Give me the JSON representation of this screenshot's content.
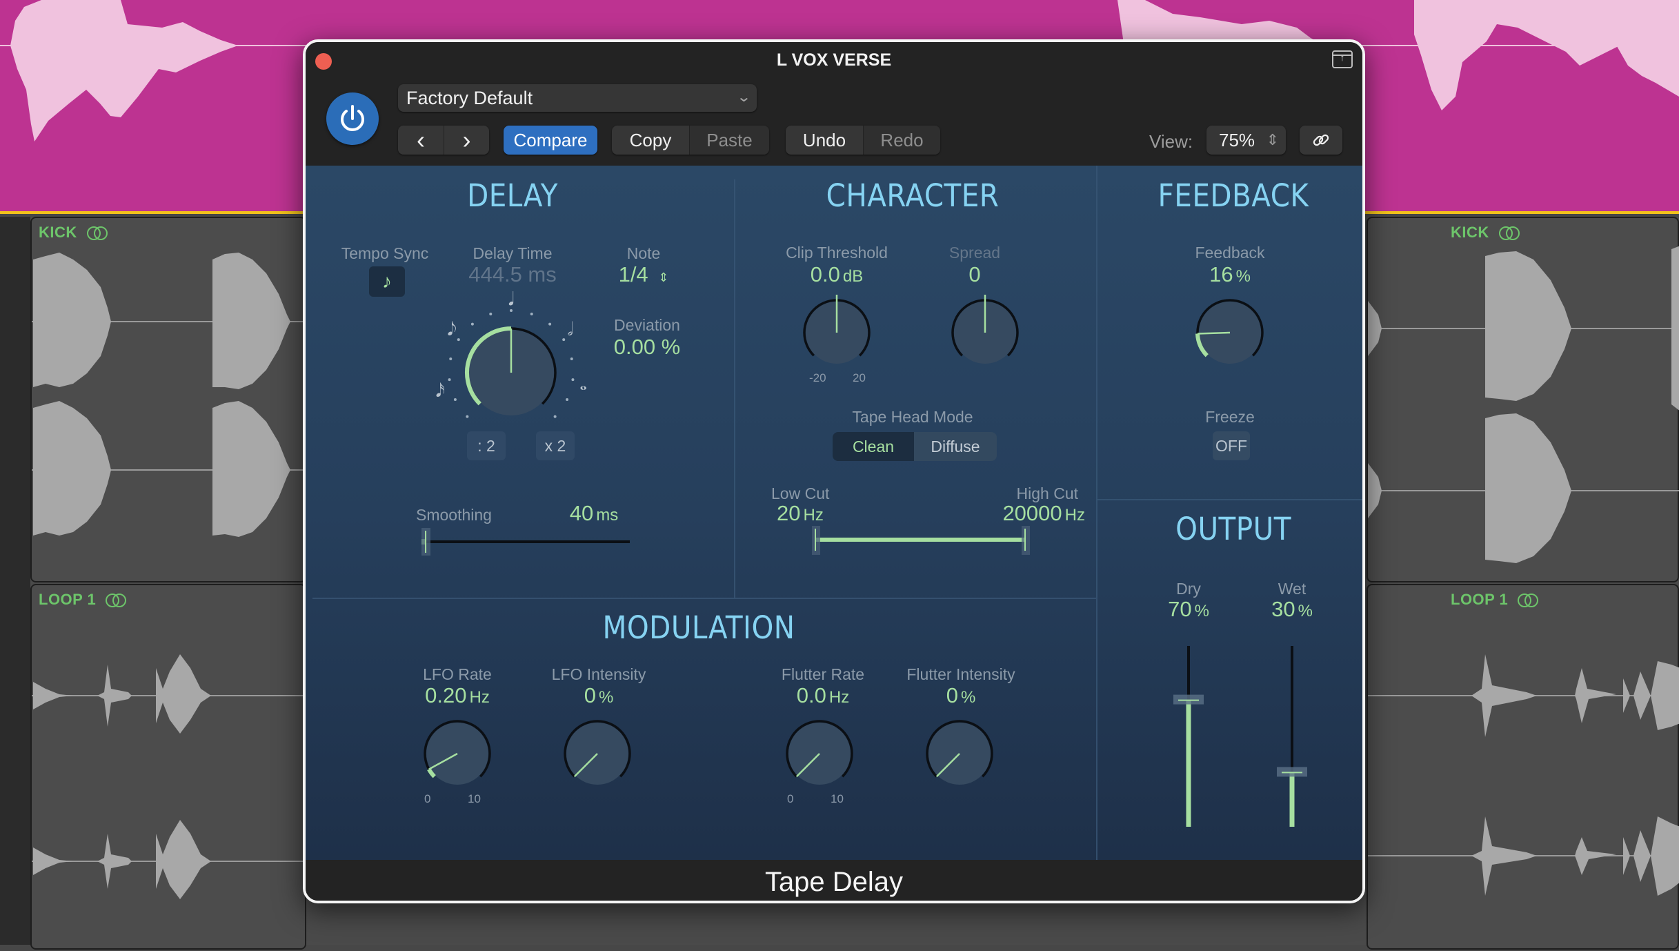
{
  "background": {
    "vox_region_color": "#bd3391",
    "tracks": [
      {
        "name": "KICK",
        "icon": "loop-icon"
      },
      {
        "name": "LOOP 1",
        "icon": "loop-icon"
      }
    ]
  },
  "window": {
    "title": "L VOX VERSE",
    "close_icon": "close-icon",
    "expand_icon": "expand-window-icon",
    "power_icon": "power-icon",
    "preset": {
      "value": "Factory Default",
      "chevron": "⌄"
    },
    "nav": {
      "prev": "‹",
      "next": "›"
    },
    "toolbar": {
      "compare": "Compare",
      "copy": "Copy",
      "paste": "Paste",
      "undo": "Undo",
      "redo": "Redo",
      "view_label": "View:",
      "view_value": "75%",
      "stepper": "⇕",
      "link_icon": "link-icon"
    },
    "footer_title": "Tape Delay"
  },
  "delay": {
    "title": "DELAY",
    "tempo_sync": {
      "label": "Tempo Sync",
      "icon": "eighth-note-icon",
      "state": "on"
    },
    "delay_time": {
      "label": "Delay Time",
      "value": "444.5 ms"
    },
    "note": {
      "label": "Note",
      "value": "1/4",
      "stepper": "⇕"
    },
    "deviation": {
      "label": "Deviation",
      "value": "0.00 %"
    },
    "knob_note_marks": [
      "𝅘𝅥𝅯",
      "𝅘𝅥𝅮",
      "𝅘𝅥",
      "𝅗𝅥",
      "𝅝"
    ],
    "knob_value_fraction": 0.5,
    "divide_btn": ": 2",
    "multiply_btn": "x 2",
    "smoothing": {
      "label": "Smoothing",
      "value": "40",
      "unit": "ms",
      "fraction": 0.02
    }
  },
  "character": {
    "title": "CHARACTER",
    "clip_threshold": {
      "label": "Clip Threshold",
      "value": "0.0",
      "unit": "dB",
      "min": "-20",
      "max": "20",
      "fraction": 0.5
    },
    "spread": {
      "label": "Spread",
      "value": "0",
      "fraction": 0.5
    },
    "tape_head_mode": {
      "label": "Tape Head Mode",
      "options": [
        "Clean",
        "Diffuse"
      ],
      "selected": "Clean"
    },
    "low_cut": {
      "label": "Low Cut",
      "value": "20",
      "unit": "Hz"
    },
    "high_cut": {
      "label": "High Cut",
      "value": "20000",
      "unit": "Hz"
    }
  },
  "feedback": {
    "title": "FEEDBACK",
    "feedback": {
      "label": "Feedback",
      "value": "16",
      "unit": "%",
      "fraction": 0.16
    },
    "freeze": {
      "label": "Freeze",
      "value": "OFF"
    }
  },
  "output": {
    "title": "OUTPUT",
    "dry": {
      "label": "Dry",
      "value": "70",
      "unit": "%",
      "fraction": 0.7
    },
    "wet": {
      "label": "Wet",
      "value": "30",
      "unit": "%",
      "fraction": 0.3
    }
  },
  "modulation": {
    "title": "MODULATION",
    "lfo_rate": {
      "label": "LFO Rate",
      "value": "0.20",
      "unit": "Hz",
      "min": "0",
      "max": "10",
      "fraction": 0.06
    },
    "lfo_intensity": {
      "label": "LFO Intensity",
      "value": "0",
      "unit": "%",
      "fraction": 0.0
    },
    "flutter_rate": {
      "label": "Flutter Rate",
      "value": "0.0",
      "unit": "Hz",
      "min": "0",
      "max": "10",
      "fraction": 0.0
    },
    "flutter_intensity": {
      "label": "Flutter Intensity",
      "value": "0",
      "unit": "%",
      "fraction": 0.0
    }
  }
}
